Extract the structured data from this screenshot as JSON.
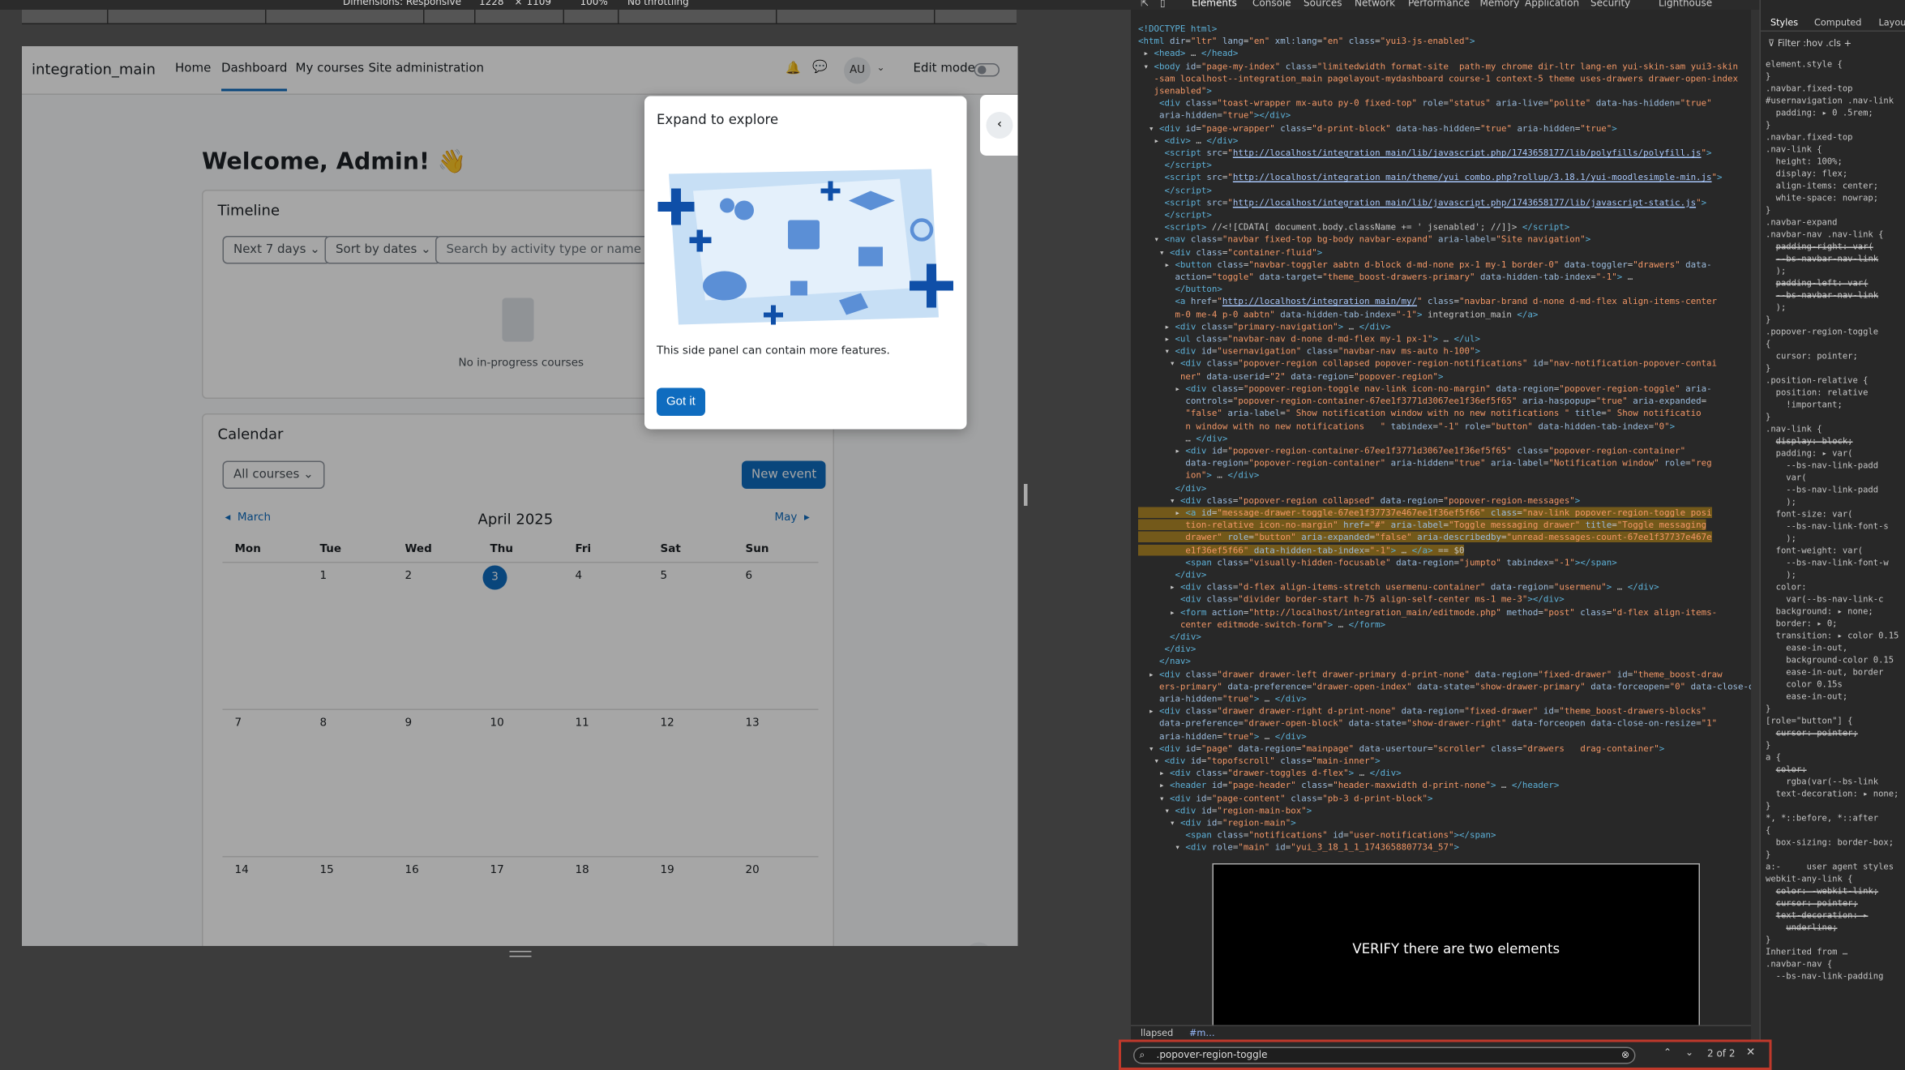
{
  "devtools_toolbar": {
    "dimensions": "Dimensions: Responsive",
    "width": "1228",
    "height": "1109",
    "zoom": "100%",
    "throttle": "No throttling"
  },
  "navbar": {
    "brand": "integration_main",
    "links": [
      "Home",
      "Dashboard",
      "My courses",
      "Site administration"
    ],
    "avatar": "AU",
    "edit_mode": "Edit mode"
  },
  "welcome": "Welcome, Admin! 👋",
  "timeline": {
    "title": "Timeline",
    "filter": "Next 7 days",
    "sort": "Sort by dates",
    "search_placeholder": "Search by activity type or name",
    "empty": "No in-progress courses"
  },
  "calendar": {
    "title": "Calendar",
    "course_filter": "All courses",
    "new_event": "New event",
    "prev": "March",
    "next": "May",
    "month": "April 2025",
    "days": [
      "Mon",
      "Tue",
      "Wed",
      "Thu",
      "Fri",
      "Sat",
      "Sun"
    ],
    "weeks": [
      [
        "",
        "1",
        "2",
        "3",
        "4",
        "5",
        "6"
      ],
      [
        "7",
        "8",
        "9",
        "10",
        "11",
        "12",
        "13"
      ],
      [
        "14",
        "15",
        "16",
        "17",
        "18",
        "19",
        "20"
      ]
    ],
    "today": "3"
  },
  "popover": {
    "title": "Expand to explore",
    "body": "This side panel can contain more features.",
    "button": "Got it"
  },
  "help": "?",
  "devtools_tabs": [
    "Elements",
    "Console",
    "Sources",
    "Network",
    "Performance",
    "Memory",
    "Application",
    "Security",
    "Lighthouse"
  ],
  "styles_tabs": [
    "Styles",
    "Computed",
    "Layou"
  ],
  "styles_filter": "Filter",
  "verify_text": "VERIFY there are two elements",
  "search": {
    "query": ".popover-region-toggle",
    "count": "2 of 2"
  },
  "breadcrumb": "llapsed"
}
